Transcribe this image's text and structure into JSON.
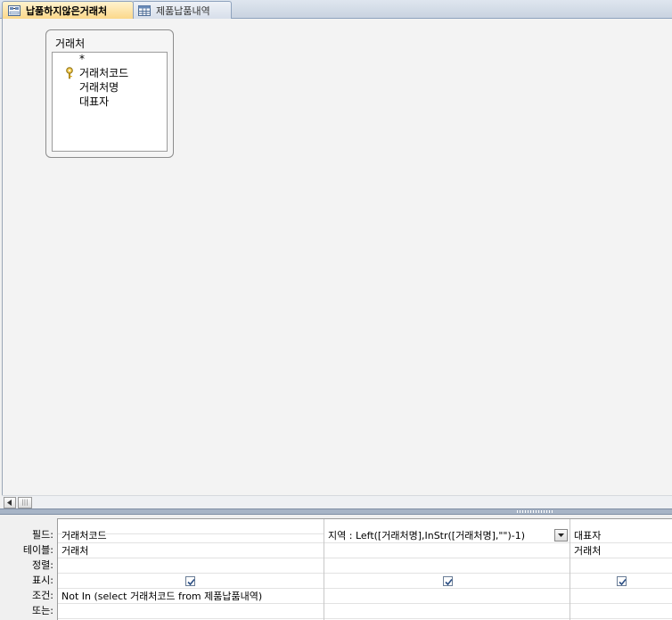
{
  "tabs": [
    {
      "label": "납품하지않은거래처",
      "active": true,
      "icon": "query-icon"
    },
    {
      "label": "제품납품내역",
      "active": false,
      "icon": "table-icon"
    }
  ],
  "field_list": {
    "title": "거래처",
    "fields": [
      "*",
      "거래처코드",
      "거래처명",
      "대표자"
    ],
    "primary_key": "거래처코드"
  },
  "grid": {
    "row_labels": [
      "필드:",
      "테이블:",
      "정렬:",
      "표시:",
      "조건:",
      "또는:"
    ],
    "columns": [
      {
        "field": "거래처코드",
        "table": "거래처",
        "sort": "",
        "show": true,
        "criteria": "Not In (select 거래처코드 from 제품납품내역)",
        "or": ""
      },
      {
        "field": "지역 : Left([거래처명],InStr([거래처명],\"\")-1)",
        "table": "",
        "sort": "",
        "show": true,
        "criteria": "",
        "or": ""
      },
      {
        "field": "대표자",
        "table": "거래처",
        "sort": "",
        "show": true,
        "criteria": "",
        "or": ""
      }
    ]
  },
  "scrollbar": {
    "thumb_glyph": "|||"
  },
  "colors": {
    "active_tab": "#fbd88a",
    "splitter": "#a7b4c6"
  }
}
